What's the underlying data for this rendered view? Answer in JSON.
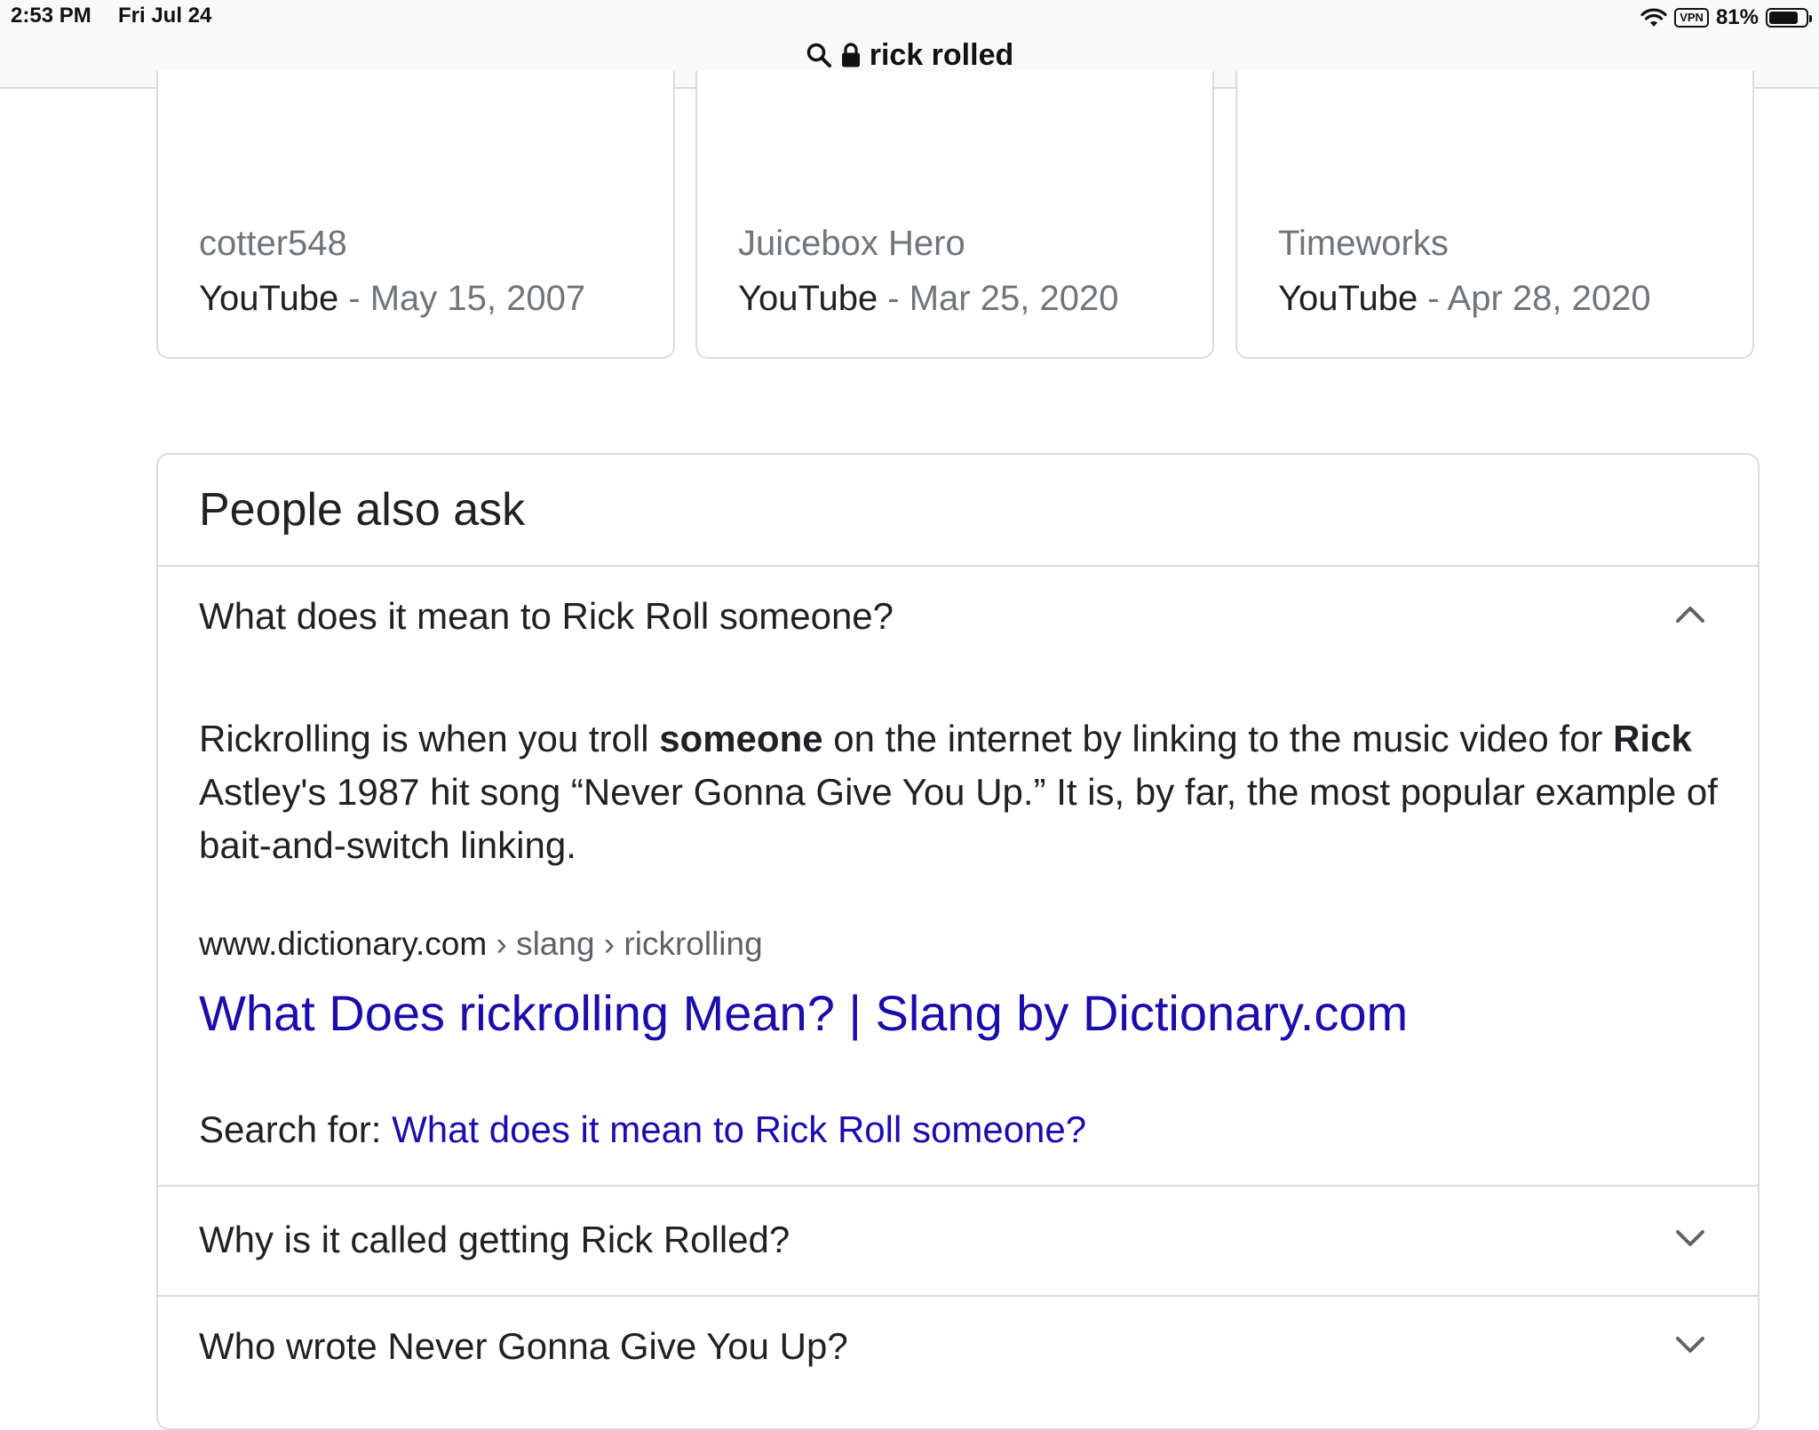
{
  "status_bar": {
    "time": "2:53 PM",
    "date": "Fri Jul 24",
    "vpn": "VPN",
    "battery": "81%",
    "battery_level": 0.81
  },
  "address_bar": {
    "query": "rick rolled"
  },
  "video_cards": [
    {
      "channel": "cotter548",
      "source": "YouTube",
      "separator": " - ",
      "date": "May 15, 2007"
    },
    {
      "channel": "Juicebox Hero",
      "source": "YouTube",
      "separator": " - ",
      "date": "Mar 25, 2020"
    },
    {
      "channel": "Timeworks",
      "source": "YouTube",
      "separator": " - ",
      "date": "Apr 28, 2020"
    }
  ],
  "people_also_ask": {
    "title": "People also ask",
    "expanded": {
      "question": "What does it mean to Rick Roll someone?",
      "answer_parts": {
        "p1": "Rickrolling is when you troll ",
        "b1": "someone",
        "p2": " on the internet by linking to the music video for ",
        "b2": "Rick",
        "p3": " Astley's 1987 hit song “Never Gonna Give You Up.” It is, by far, the most popular example of bait-and-switch linking."
      },
      "source_domain": "www.dictionary.com",
      "source_crumbs": " › slang › rickrolling",
      "link_title": "What Does rickrolling Mean? | Slang by Dictionary.com",
      "search_for_label": "Search for: ",
      "search_for_query": "What does it mean to Rick Roll someone?"
    },
    "collapsed": [
      {
        "question": "Why is it called getting Rick Rolled?"
      },
      {
        "question": "Who wrote Never Gonna Give You Up?"
      }
    ]
  },
  "colors": {
    "link": "#1a0dab",
    "muted": "#70757a",
    "border": "#dadce0"
  }
}
